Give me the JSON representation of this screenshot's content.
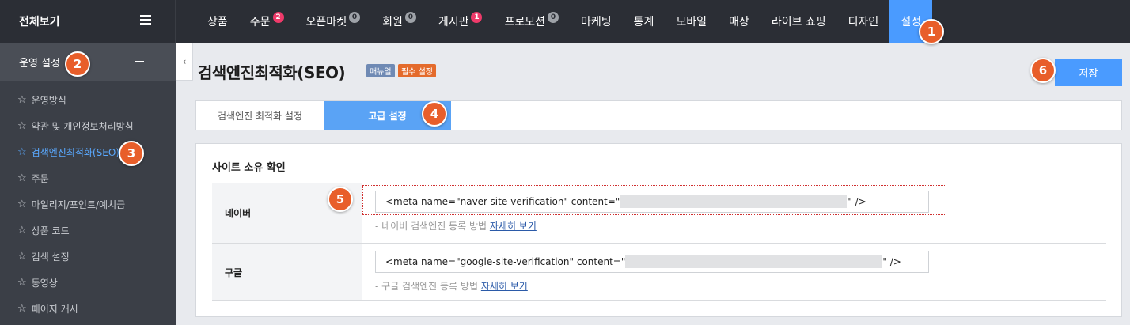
{
  "brand": {
    "label": "전체보기"
  },
  "nav": [
    {
      "label": "상품",
      "badge": null,
      "active": false
    },
    {
      "label": "주문",
      "badge": "2",
      "badge_color": "red",
      "active": false
    },
    {
      "label": "오픈마켓",
      "badge": "0",
      "badge_color": "gray",
      "active": false
    },
    {
      "label": "회원",
      "badge": "0",
      "badge_color": "gray",
      "active": false
    },
    {
      "label": "게시판",
      "badge": "1",
      "badge_color": "red",
      "active": false
    },
    {
      "label": "프로모션",
      "badge": "0",
      "badge_color": "gray",
      "active": false
    },
    {
      "label": "마케팅",
      "badge": null,
      "active": false
    },
    {
      "label": "통계",
      "badge": null,
      "active": false
    },
    {
      "label": "모바일",
      "badge": null,
      "active": false
    },
    {
      "label": "매장",
      "badge": null,
      "active": false
    },
    {
      "label": "라이브 쇼핑",
      "badge": null,
      "active": false
    },
    {
      "label": "디자인",
      "badge": null,
      "active": false
    },
    {
      "label": "설정",
      "badge": null,
      "active": true
    }
  ],
  "sidebar": {
    "section": "운영 설정",
    "items": [
      {
        "label": "운영방식",
        "selected": false
      },
      {
        "label": "약관 및 개인정보처리방침",
        "selected": false
      },
      {
        "label": "검색엔진최적화(SEO)",
        "selected": true
      },
      {
        "label": "주문",
        "selected": false
      },
      {
        "label": "마일리지/포인트/예치금",
        "selected": false
      },
      {
        "label": "상품 코드",
        "selected": false
      },
      {
        "label": "검색 설정",
        "selected": false
      },
      {
        "label": "동영상",
        "selected": false
      },
      {
        "label": "페이지 캐시",
        "selected": false
      }
    ]
  },
  "page": {
    "title": "검색엔진최적화(SEO)",
    "tag_manual": "매뉴얼",
    "tag_required": "필수 설정",
    "save_label": "저장"
  },
  "tabs": [
    {
      "label": "검색엔진 최적화 설정",
      "active": false
    },
    {
      "label": "고급 설정",
      "active": true
    }
  ],
  "panel": {
    "title": "사이트 소유 확인",
    "rows": [
      {
        "label": "네이버",
        "meta_prefix": "<meta name=\"naver-site-verification\" content=\"",
        "meta_suffix": "\" />",
        "help_text": "- 네이버 검색엔진 등록 방법",
        "help_link": "자세히 보기"
      },
      {
        "label": "구글",
        "meta_prefix": "<meta name=\"google-site-verification\" content=\"",
        "meta_suffix": "\" />",
        "help_text": "- 구글 검색엔진 등록 방법",
        "help_link": "자세히 보기"
      }
    ]
  },
  "callouts": [
    "1",
    "2",
    "3",
    "4",
    "5",
    "6"
  ],
  "colors": {
    "accent": "#4a9bff",
    "callout": "#e85e2a",
    "topbar": "#2b2e35",
    "sidebar": "#3b3f47"
  }
}
